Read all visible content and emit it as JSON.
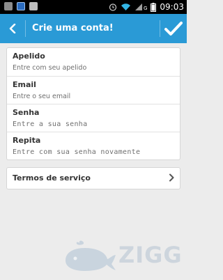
{
  "status_bar": {
    "time": "09:03",
    "network": "G",
    "icons": [
      "app-notification-icon",
      "qq-icon",
      "bag-icon",
      "alarm-icon",
      "wifi-icon",
      "signal-icon",
      "battery-icon"
    ]
  },
  "app_bar": {
    "title": "Crie uma conta!",
    "back_icon": "chevron-left-icon",
    "confirm_icon": "checkmark-icon",
    "color": "#2a9ad6"
  },
  "form": {
    "fields": [
      {
        "label": "Apelido",
        "placeholder": "Entre com seu apelido",
        "value": ""
      },
      {
        "label": "Email",
        "placeholder": "Entre o seu email",
        "value": ""
      },
      {
        "label": "Senha",
        "placeholder": "Entre a sua senha",
        "value": ""
      },
      {
        "label": "Repita",
        "placeholder": "Entre com sua senha novamente",
        "value": ""
      }
    ]
  },
  "terms": {
    "label": "Termos de serviço",
    "icon": "chevron-right-icon"
  },
  "watermark": {
    "text": "ZIGG",
    "icon": "whale-icon"
  }
}
